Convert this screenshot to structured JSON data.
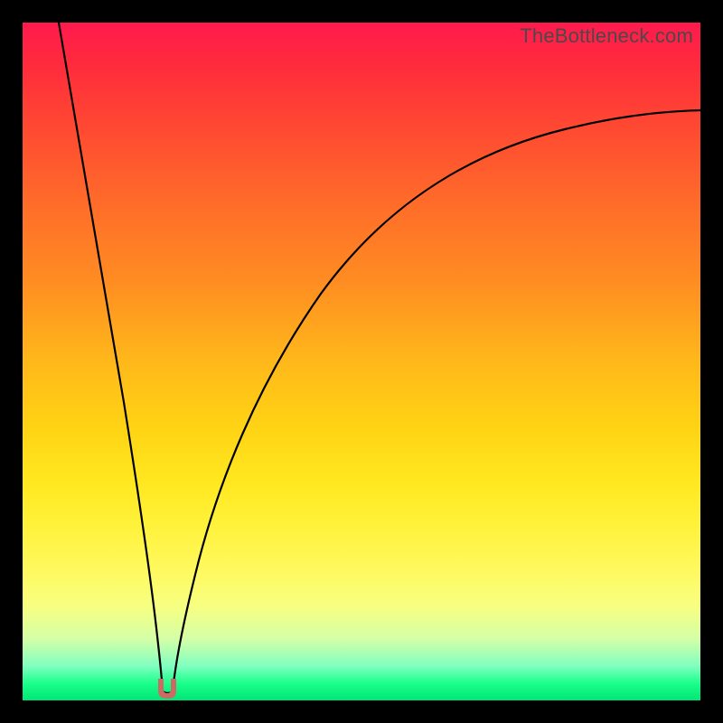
{
  "watermark": "TheBottleneck.com",
  "colors": {
    "frame_bg_top": "#ff1a4d",
    "frame_bg_bottom": "#00e676",
    "curve_stroke": "#000000",
    "marker_fill": "#cc6b66",
    "page_bg": "#000000",
    "watermark_text": "#4a4a4a"
  },
  "chart_data": {
    "type": "line",
    "title": "",
    "xlabel": "",
    "ylabel": "",
    "xlim": [
      0,
      100
    ],
    "ylim": [
      0,
      100
    ],
    "series": [
      {
        "name": "left-branch",
        "x": [
          5,
          7,
          9,
          11,
          13,
          15,
          17,
          18.5,
          19.5,
          20
        ],
        "y": [
          100,
          85,
          70,
          55,
          41,
          28,
          16,
          7,
          2.5,
          1
        ]
      },
      {
        "name": "right-branch",
        "x": [
          21,
          22,
          24,
          27,
          31,
          36,
          43,
          52,
          63,
          76,
          90,
          100
        ],
        "y": [
          1,
          4,
          12,
          24,
          36,
          47,
          57,
          66,
          74,
          80,
          84,
          86
        ]
      }
    ],
    "marker": {
      "x": 20.5,
      "y": 1.5,
      "shape": "u"
    },
    "grid": false,
    "legend": false
  }
}
